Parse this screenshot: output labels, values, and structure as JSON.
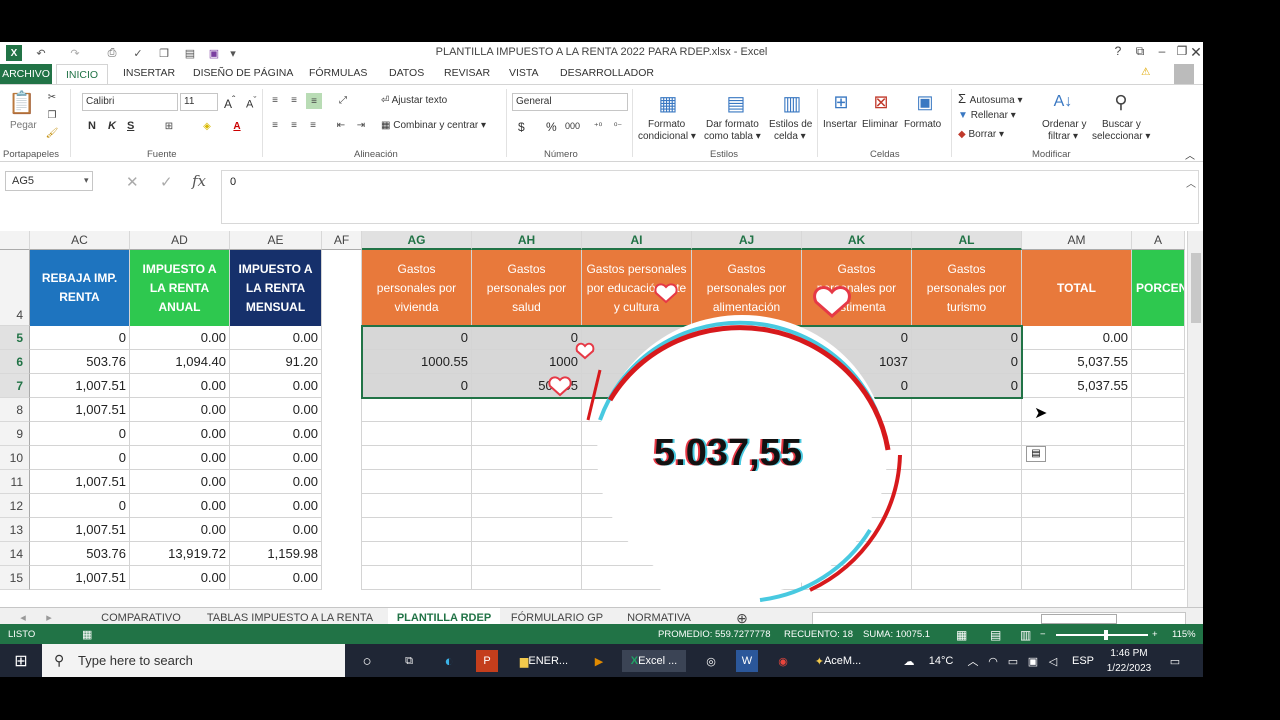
{
  "window": {
    "title": "PLANTILLA IMPUESTO A LA RENTA 2022 PARA RDEP.xlsx - Excel"
  },
  "ribbon_tabs": [
    "ARCHIVO",
    "INICIO",
    "INSERTAR",
    "DISEÑO DE PÁGINA",
    "FÓRMULAS",
    "DATOS",
    "REVISAR",
    "VISTA",
    "DESARROLLADOR"
  ],
  "ribbon": {
    "paste": "Pegar",
    "font_name": "Calibri",
    "font_size": "11",
    "bold": "N",
    "italic": "K",
    "underline": "S",
    "wrap_text": "Ajustar texto",
    "merge_center": "Combinar y centrar",
    "number_format": "General",
    "currency": "$",
    "percent": "%",
    "thousands": "000",
    "cond_format": [
      "Formato",
      "condicional"
    ],
    "table_format": [
      "Dar formato",
      "como tabla"
    ],
    "cell_styles": [
      "Estilos de",
      "celda"
    ],
    "insert": "Insertar",
    "delete": "Eliminar",
    "format": "Formato",
    "autosum": "Autosuma",
    "fill": "Rellenar",
    "clear": "Borrar",
    "sort_filter": [
      "Ordenar y",
      "filtrar"
    ],
    "find_select": [
      "Buscar y",
      "seleccionar"
    ],
    "groups": [
      "Portapapeles",
      "Fuente",
      "Alineación",
      "Número",
      "Estilos",
      "Celdas",
      "Modificar"
    ]
  },
  "formula_bar": {
    "name_box": "AG5",
    "fx": "fx",
    "value": "0"
  },
  "columns": [
    "AC",
    "AD",
    "AE",
    "AF",
    "AG",
    "AH",
    "AI",
    "AJ",
    "AK",
    "AL",
    "AM",
    "AN"
  ],
  "rows": [
    "4",
    "5",
    "6",
    "7",
    "8",
    "9",
    "10",
    "11",
    "12",
    "13",
    "14",
    "15"
  ],
  "headers": {
    "AC": "REBAJA IMP. RENTA",
    "AD": "IMPUESTO A LA RENTA ANUAL",
    "AE": "IMPUESTO A LA RENTA MENSUAL",
    "AG": "Gastos personales por vivienda",
    "AH": "Gastos personales por salud",
    "AI": "Gastos personales por educación arte y cultura",
    "AJ": "Gastos personales por alimentación",
    "AK": "Gastos personales por vestimenta",
    "AL": "Gastos personales por turismo",
    "AM": "TOTAL",
    "AN": "PORCEN... DISCAP..."
  },
  "left_table": [
    {
      "row": "5",
      "AC": "0",
      "AD": "0.00",
      "AE": "0.00"
    },
    {
      "row": "6",
      "AC": "503.76",
      "AD": "1,094.40",
      "AE": "91.20"
    },
    {
      "row": "7",
      "AC": "1,007.51",
      "AD": "0.00",
      "AE": "0.00"
    },
    {
      "row": "8",
      "AC": "1,007.51",
      "AD": "0.00",
      "AE": "0.00"
    },
    {
      "row": "9",
      "AC": "0",
      "AD": "0.00",
      "AE": "0.00"
    },
    {
      "row": "10",
      "AC": "0",
      "AD": "0.00",
      "AE": "0.00"
    },
    {
      "row": "11",
      "AC": "1,007.51",
      "AD": "0.00",
      "AE": "0.00"
    },
    {
      "row": "12",
      "AC": "0",
      "AD": "0.00",
      "AE": "0.00"
    },
    {
      "row": "13",
      "AC": "1,007.51",
      "AD": "0.00",
      "AE": "0.00"
    },
    {
      "row": "14",
      "AC": "503.76",
      "AD": "13,919.72",
      "AE": "1,159.98"
    },
    {
      "row": "15",
      "AC": "1,007.51",
      "AD": "0.00",
      "AE": "0.00"
    }
  ],
  "right_table": [
    {
      "row": "5",
      "AG": "0",
      "AH": "0",
      "AK": "0",
      "AL": "0",
      "AM": "0.00"
    },
    {
      "row": "6",
      "AG": "1000.55",
      "AH": "1000",
      "AK": "1037",
      "AL": "0",
      "AM": "5,037.55"
    },
    {
      "row": "7",
      "AG": "0",
      "AH": "503.55",
      "AK": "0",
      "AL": "0",
      "AM": "5,037.55"
    }
  ],
  "sheet_tabs": [
    "COMPARATIVO",
    "TABLAS IMPUESTO A LA RENTA",
    "PLANTILLA RDEP",
    "FÓRMULARIO GP",
    "NORMATIVA"
  ],
  "active_sheet": "PLANTILLA RDEP",
  "status": {
    "mode": "LISTO",
    "average": "PROMEDIO: 559.7277778",
    "count": "RECUENTO: 18",
    "sum": "SUMA: 10075.1",
    "zoom": "115%"
  },
  "taskbar": {
    "search_placeholder": "Type here to search",
    "apps": [
      "ENER...",
      "Excel ...",
      "AceM..."
    ],
    "weather": "14°C",
    "lang": "ESP",
    "time": "1:46 PM",
    "date": "1/22/2023"
  },
  "overlay": {
    "bubble_value": "5.037,55"
  },
  "colors": {
    "excel_green": "#217346",
    "blue_header": "#1e74bf",
    "green_header": "#2ec84f",
    "navy_header": "#16306b",
    "orange_header": "#e8793b",
    "bright_green_header": "#2ec84f"
  }
}
